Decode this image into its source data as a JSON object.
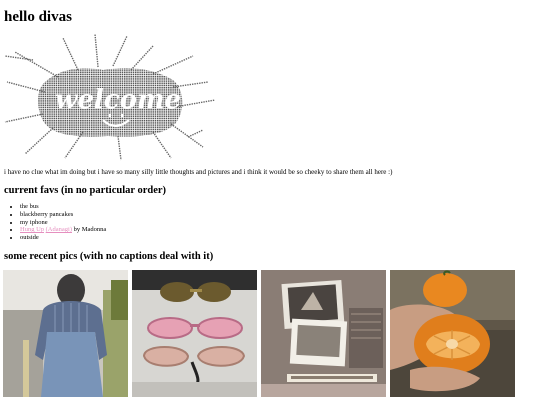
{
  "page": {
    "title": "hello divas",
    "welcome_art_text": "welcome",
    "intro": "i have no clue what im doing but i have so many silly little thoughts and pictures and i think it would be so cheeky to share them all here :)"
  },
  "favs": {
    "heading": "current favs (in no particular order)",
    "items": [
      {
        "text": "the bus"
      },
      {
        "text": "blackberry pancakes"
      },
      {
        "text": "my iphone"
      },
      {
        "link": "Hung Up",
        "sep": " ",
        "link2": "(Adanagi)",
        "suffix": " by Madonna"
      },
      {
        "text": "outside"
      }
    ]
  },
  "pics": {
    "heading": "some recent pics (with no captions deal with it)",
    "photos": [
      {
        "subject": "person in striped shirt and blue skirt"
      },
      {
        "subject": "sunglasses on a table"
      },
      {
        "subject": "photographs on a table"
      },
      {
        "subject": "tangerine held in hand"
      }
    ]
  },
  "colors": {
    "link": "#e58fbf",
    "text": "#000000",
    "background": "#ffffff"
  }
}
